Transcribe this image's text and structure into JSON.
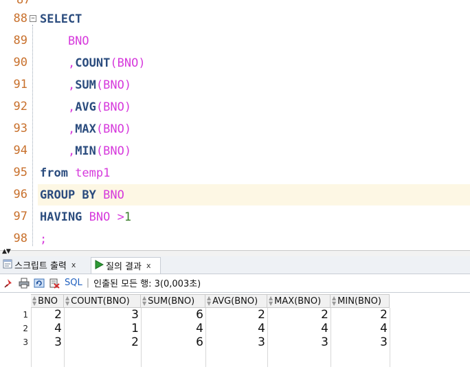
{
  "editor": {
    "top_partial_number": "87",
    "lines": [
      {
        "num": "88",
        "tokens": [
          {
            "t": "SELECT",
            "c": "kw"
          }
        ]
      },
      {
        "num": "89",
        "tokens": [
          {
            "t": "    BNO",
            "c": "id"
          }
        ]
      },
      {
        "num": "90",
        "tokens": [
          {
            "t": "    ,",
            "c": "id"
          },
          {
            "t": "COUNT",
            "c": "kw"
          },
          {
            "t": "(BNO)",
            "c": "id"
          }
        ]
      },
      {
        "num": "91",
        "tokens": [
          {
            "t": "    ,",
            "c": "id"
          },
          {
            "t": "SUM",
            "c": "kw"
          },
          {
            "t": "(BNO)",
            "c": "id"
          }
        ]
      },
      {
        "num": "92",
        "tokens": [
          {
            "t": "    ,",
            "c": "id"
          },
          {
            "t": "AVG",
            "c": "kw"
          },
          {
            "t": "(BNO)",
            "c": "id"
          }
        ]
      },
      {
        "num": "93",
        "tokens": [
          {
            "t": "    ,",
            "c": "id"
          },
          {
            "t": "MAX",
            "c": "kw"
          },
          {
            "t": "(BNO)",
            "c": "id"
          }
        ]
      },
      {
        "num": "94",
        "tokens": [
          {
            "t": "    ,",
            "c": "id"
          },
          {
            "t": "MIN",
            "c": "kw"
          },
          {
            "t": "(BNO)",
            "c": "id"
          }
        ]
      },
      {
        "num": "95",
        "tokens": [
          {
            "t": "from ",
            "c": "kw"
          },
          {
            "t": "temp1",
            "c": "id"
          }
        ]
      },
      {
        "num": "96",
        "tokens": [
          {
            "t": "GROUP BY ",
            "c": "kw"
          },
          {
            "t": "BNO",
            "c": "id"
          }
        ]
      },
      {
        "num": "97",
        "tokens": [
          {
            "t": "HAVING ",
            "c": "kw"
          },
          {
            "t": "BNO >",
            "c": "id"
          },
          {
            "t": "1",
            "c": "num"
          }
        ]
      },
      {
        "num": "98",
        "tokens": [
          {
            "t": ";",
            "c": "id"
          }
        ]
      }
    ]
  },
  "tabs": [
    {
      "label": "스크립트 출력",
      "close": "x",
      "icon": "script-output-icon"
    },
    {
      "label": "질의 결과",
      "close": "x",
      "icon": "run-triangle-icon"
    }
  ],
  "toolbar": {
    "sql_label": "SQL",
    "separator": "|",
    "status": "인출된 모든 행: 3(0,003초)",
    "icons": [
      "pin-icon",
      "print-icon",
      "refresh-icon",
      "export-icon"
    ]
  },
  "results": {
    "columns": [
      "BNO",
      "COUNT(BNO)",
      "SUM(BNO)",
      "AVG(BNO)",
      "MAX(BNO)",
      "MIN(BNO)"
    ],
    "rows": [
      {
        "rownum": "1",
        "cells": [
          "2",
          "3",
          "6",
          "2",
          "2",
          "2"
        ]
      },
      {
        "rownum": "2",
        "cells": [
          "4",
          "1",
          "4",
          "4",
          "4",
          "4"
        ]
      },
      {
        "rownum": "3",
        "cells": [
          "3",
          "2",
          "6",
          "3",
          "3",
          "3"
        ]
      }
    ]
  },
  "colors": {
    "keyword": "#2b4c7e",
    "identifier": "#d63adc",
    "number": "#3a7d2a",
    "line_number": "#c8702c",
    "current_line": "#fdf7e4"
  }
}
